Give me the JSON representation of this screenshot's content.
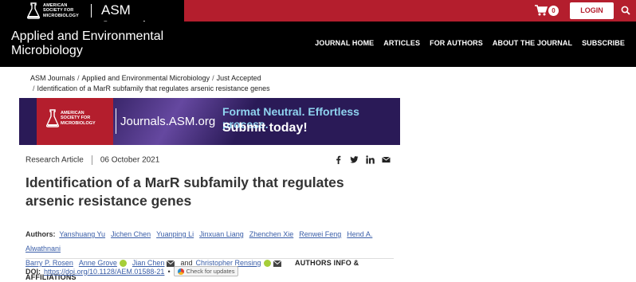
{
  "topbar": {
    "society_lines": [
      "AMERICAN",
      "SOCIETY FOR",
      "MICROBIOLOGY"
    ],
    "site_name": "ASM Journals",
    "cart_count": "0",
    "login_label": "LOGIN"
  },
  "journal": {
    "title": "Applied and Environmental Microbiology",
    "nav": [
      "JOURNAL HOME",
      "ARTICLES",
      "FOR AUTHORS",
      "ABOUT THE JOURNAL",
      "SUBSCRIBE"
    ]
  },
  "breadcrumb": {
    "items": [
      "ASM Journals",
      "Applied and Environmental Microbiology",
      "Just Accepted"
    ],
    "current": "Identification of a MarR subfamily that regulates arsenic resistance genes"
  },
  "ad": {
    "society_lines": [
      "AMERICAN",
      "SOCIETY FOR",
      "MICROBIOLOGY"
    ],
    "url": "Journals.ASM.org",
    "tagline1": "Format Neutral.  Effortless process.",
    "tagline2": "Submit today!"
  },
  "article": {
    "type": "Research Article",
    "date": "06 October 2021",
    "title": "Identification of a MarR subfamily that regulates arsenic resistance genes",
    "authors_label": "Authors",
    "authors": [
      "Yanshuang Yu",
      "Jichen Chen",
      "Yuanping Li",
      "Jinxuan Liang",
      "Zhenchen Xie",
      "Renwei Feng",
      "Hend A. Alwathnani",
      "Barry P. Rosen",
      "Anne Grove",
      "Jian Chen",
      "Christopher Rensing"
    ],
    "and_text": "and",
    "authors_info": "AUTHORS INFO & AFFILIATIONS",
    "doi_label": "DOI:",
    "doi": "https://doi.org/10.1128/AEM.01588-21",
    "bullet": "•",
    "check_updates": "Check for updates"
  }
}
